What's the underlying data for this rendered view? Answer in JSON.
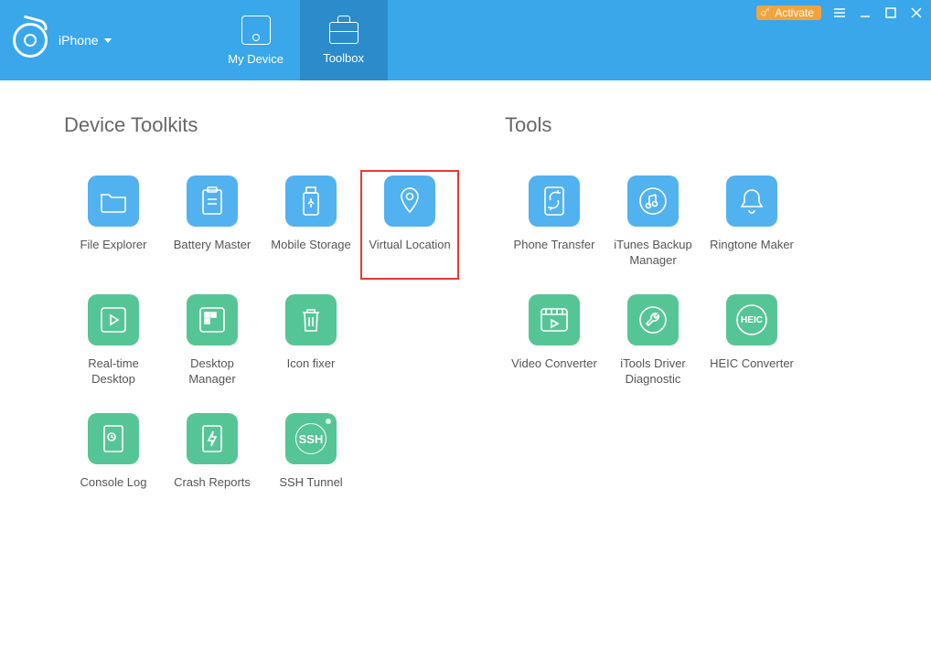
{
  "header": {
    "device_label": "iPhone",
    "tabs": {
      "my_device": "My Device",
      "toolbox": "Toolbox"
    },
    "activate": "Activate"
  },
  "sections": {
    "device_toolkits_title": "Device Toolkits",
    "tools_title": "Tools"
  },
  "device_toolkits": {
    "file_explorer": "File Explorer",
    "battery_master": "Battery Master",
    "mobile_storage": "Mobile Storage",
    "virtual_location": "Virtual Location",
    "realtime_desktop": "Real-time Desktop",
    "desktop_manager": "Desktop Manager",
    "icon_fixer": "Icon fixer",
    "console_log": "Console Log",
    "crash_reports": "Crash Reports",
    "ssh_tunnel": "SSH Tunnel"
  },
  "tools": {
    "phone_transfer": "Phone Transfer",
    "itunes_backup": "iTunes Backup Manager",
    "ringtone_maker": "Ringtone Maker",
    "video_converter": "Video Converter",
    "driver_diagnostic": "iTools Driver Diagnostic",
    "heic_converter": "HEIC Converter",
    "heic_badge": "HEIC"
  },
  "colors": {
    "blue": "#52b2ef",
    "green": "#56c596",
    "header": "#39a7ea",
    "activate": "#f3a33c",
    "highlight": "#e53935"
  }
}
